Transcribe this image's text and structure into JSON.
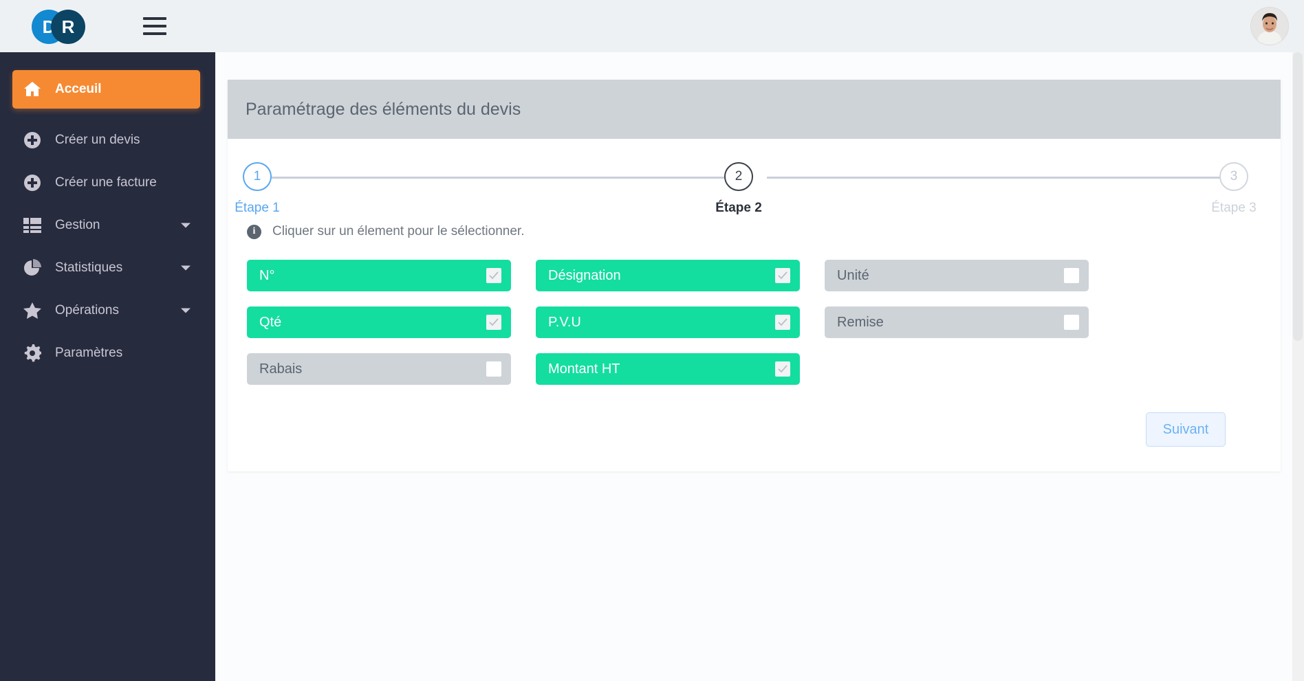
{
  "brand": {
    "logo_left_letter": "D",
    "logo_right_letter": "R",
    "accent_orange": "#f68a33",
    "accent_green": "#14dda0",
    "accent_blue": "#5aa7f0",
    "sidebar_bg": "#262b3e",
    "topbar_bg": "#eef1f4"
  },
  "topbar": {
    "menu_icon": "hamburger-icon",
    "avatar_icon": "user-avatar"
  },
  "sidebar": {
    "items": [
      {
        "label": "Acceuil",
        "icon": "home-icon",
        "active": true,
        "caret": false
      },
      {
        "label": "Créer un devis",
        "icon": "plus-circle-icon",
        "active": false,
        "caret": false
      },
      {
        "label": "Créer une facture",
        "icon": "plus-circle-icon",
        "active": false,
        "caret": false
      },
      {
        "label": "Gestion",
        "icon": "list-icon",
        "active": false,
        "caret": true
      },
      {
        "label": "Statistiques",
        "icon": "pie-chart-icon",
        "active": false,
        "caret": true
      },
      {
        "label": "Opérations",
        "icon": "star-icon",
        "active": false,
        "caret": true
      },
      {
        "label": "Paramètres",
        "icon": "gear-icon",
        "active": false,
        "caret": false
      }
    ]
  },
  "card": {
    "title": "Paramétrage des éléments du devis"
  },
  "stepper": {
    "steps": [
      {
        "number": "1",
        "label": "Étape 1",
        "state": "done"
      },
      {
        "number": "2",
        "label": "Étape 2",
        "state": "active"
      },
      {
        "number": "3",
        "label": "Étape 3",
        "state": "todo"
      }
    ]
  },
  "hint": {
    "icon": "info-icon",
    "text": "Cliquer sur un élement pour le sélectionner."
  },
  "tiles": [
    {
      "label": "N°",
      "selected": true
    },
    {
      "label": "Désignation",
      "selected": true
    },
    {
      "label": "Unité",
      "selected": false
    },
    {
      "label": "Qté",
      "selected": true
    },
    {
      "label": "P.V.U",
      "selected": true
    },
    {
      "label": "Remise",
      "selected": false
    },
    {
      "label": "Rabais",
      "selected": false
    },
    {
      "label": "Montant HT",
      "selected": true
    }
  ],
  "footer": {
    "next_label": "Suivant"
  }
}
